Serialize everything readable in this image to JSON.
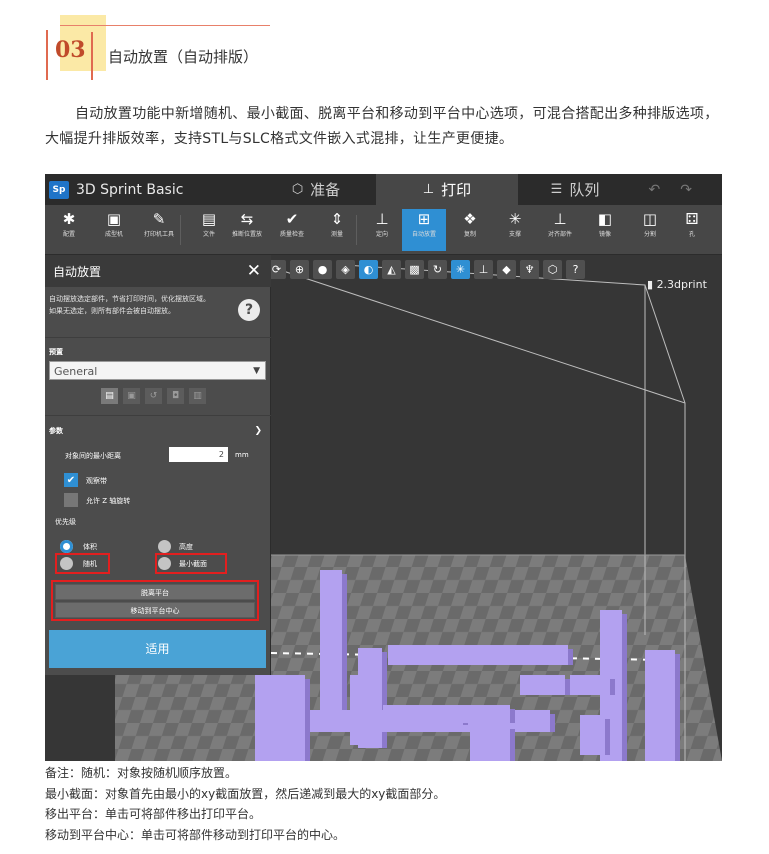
{
  "section": {
    "number": "03",
    "title": "自动放置（自动排版）"
  },
  "intro": "自动放置功能中新增随机、最小截面、脱离平台和移动到平台中心选项，可混合搭配出多种排版选项，大幅提升排版效率，支持STL与SLC格式文件嵌入式混排，让生产更便捷。",
  "app": {
    "logo": "Sp",
    "name": "3D Sprint Basic",
    "tabs": [
      {
        "label": "准备",
        "icon": "cube-icon"
      },
      {
        "label": "打印",
        "icon": "print-icon"
      },
      {
        "label": "队列",
        "icon": "queue-icon"
      }
    ],
    "undo_redo": "↶↷"
  },
  "toolbar": [
    {
      "icon": "gear-icon",
      "glyph": "✱",
      "label": "配置"
    },
    {
      "icon": "printer-icon",
      "glyph": "▣",
      "label": "成型机"
    },
    {
      "icon": "wrench-icon",
      "glyph": "✎",
      "label": "打印机工具"
    },
    {
      "icon": "file-icon",
      "glyph": "▤",
      "label": "文件"
    },
    {
      "icon": "replace-icon",
      "glyph": "⇆",
      "label": "推断位置放"
    },
    {
      "icon": "check-icon",
      "glyph": "✔",
      "label": "质量检查"
    },
    {
      "icon": "measure-icon",
      "glyph": "⇕",
      "label": "测量"
    },
    {
      "icon": "orient-icon",
      "glyph": "⊥",
      "label": "定向"
    },
    {
      "icon": "auto-place-icon",
      "glyph": "⊞",
      "label": "自动放置"
    },
    {
      "icon": "copy-icon",
      "glyph": "❖",
      "label": "复制"
    },
    {
      "icon": "support-icon",
      "glyph": "✳",
      "label": "支撑"
    },
    {
      "icon": "align-icon",
      "glyph": "⊥",
      "label": "对齐部件"
    },
    {
      "icon": "mirror-icon",
      "glyph": "◧",
      "label": "镜像"
    },
    {
      "icon": "split-icon",
      "glyph": "◫",
      "label": "分割"
    },
    {
      "icon": "hole-icon",
      "glyph": "⚃",
      "label": "孔"
    }
  ],
  "viewport": {
    "file": "2.3dprint"
  },
  "panel": {
    "title": "自动放置",
    "desc1": "自动摆放选定部件，节省打印时间，优化摆放区域。",
    "desc2": "如果无选定，则所有部件会被自动摆放。",
    "preset_label": "预置",
    "preset_value": "General",
    "params_label": "参数",
    "dist_label": "对象间的最小距离",
    "dist_value": "2",
    "dist_unit": "mm",
    "cb1": "观察带",
    "cb2": "允许 Z 轴旋转",
    "priority": "优先级",
    "r_volume": "体积",
    "r_height": "高度",
    "r_random": "随机",
    "r_min_section": "最小截面",
    "btn_detach": "脱离平台",
    "btn_center": "移动到平台中心",
    "apply": "适用"
  },
  "notes": [
    "备注：随机：对象按随机顺序放置。",
    "最小截面：对象首先由最小的xy截面放置，然后递减到最大的xy截面部分。",
    "移出平台：单击可将部件移出打印平台。",
    "移动到平台中心：单击可将部件移动到打印平台的中心。"
  ],
  "colors": {
    "accent": "#2f8fd3",
    "highlight_box": "#e21f1f",
    "part": "#b3a1f0"
  }
}
